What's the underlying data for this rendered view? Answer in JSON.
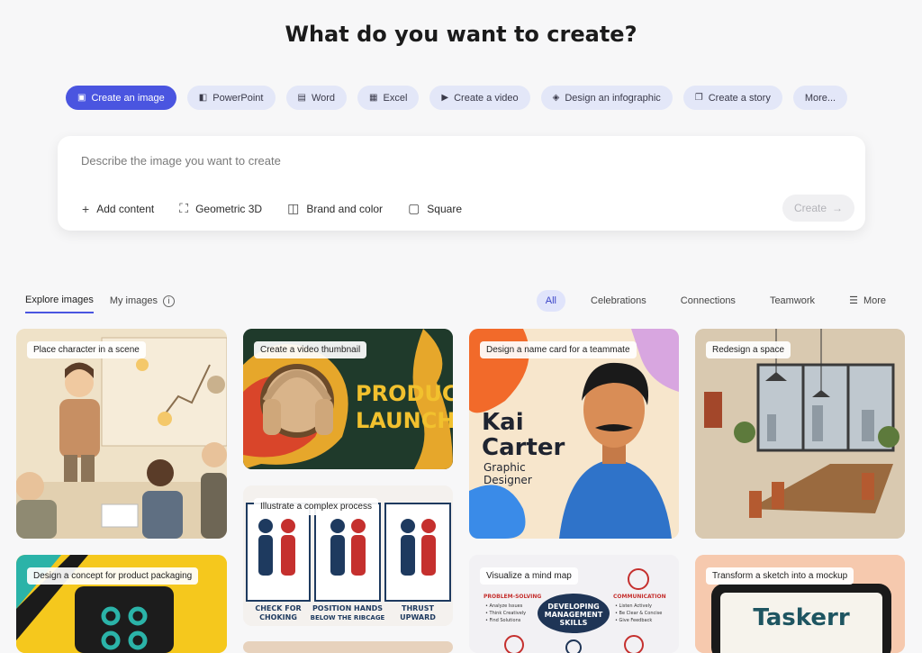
{
  "page": {
    "title": "What do you want to create?"
  },
  "chips": [
    {
      "label": "Create an image",
      "icon": "image-icon"
    },
    {
      "label": "PowerPoint",
      "icon": "powerpoint-icon"
    },
    {
      "label": "Word",
      "icon": "word-icon"
    },
    {
      "label": "Excel",
      "icon": "excel-icon"
    },
    {
      "label": "Create a video",
      "icon": "video-icon"
    },
    {
      "label": "Design an infographic",
      "icon": "infographic-icon"
    },
    {
      "label": "Create a story",
      "icon": "story-icon"
    },
    {
      "label": "More...",
      "icon": ""
    }
  ],
  "prompt": {
    "placeholder": "Describe the image you want to create",
    "value": "",
    "options": [
      {
        "label": "Add content",
        "icon": "plus-icon"
      },
      {
        "label": "Geometric 3D",
        "icon": "style-icon"
      },
      {
        "label": "Brand and color",
        "icon": "palette-icon"
      },
      {
        "label": "Square",
        "icon": "aspect-ratio-icon"
      }
    ],
    "create_label": "Create"
  },
  "tabs": {
    "explore": "Explore images",
    "mine": "My images"
  },
  "filters": {
    "all": "All",
    "celebrations": "Celebrations",
    "connections": "Connections",
    "teamwork": "Teamwork",
    "more": "More"
  },
  "cards": {
    "c1": "Place character in a scene",
    "c2": "Create a video thumbnail",
    "c3": "Design a name card for a teammate",
    "c4": "Redesign a space",
    "c5": "Illustrate a complex process",
    "c6": "Design a concept for product packaging",
    "c7": "Visualize a mind map",
    "c8": "Transform a sketch into a mockup"
  },
  "card_text": {
    "product": "PRODUCT",
    "launch": "LAUNCH",
    "kai": "Kai",
    "carter": "Carter",
    "graphic": "Graphic",
    "designer": "Designer",
    "step1a": "CHECK FOR",
    "step1b": "CHOKING",
    "step2a": "POSITION HANDS",
    "step2b": "BELOW THE RIBCAGE",
    "step3a": "THRUST",
    "step3b": "UPWARD",
    "mind_center_1": "DEVELOPING",
    "mind_center_2": "MANAGEMENT",
    "mind_center_3": "SKILLS",
    "mind_left_head": "PROBLEM-SOLVING",
    "mind_left_1": "• Analyze Issues",
    "mind_left_2": "• Think Creatively",
    "mind_left_3": "• Find Solutions",
    "mind_right_head": "COMMUNICATION",
    "mind_right_1": "• Listen Actively",
    "mind_right_2": "• Be Clear & Concise",
    "mind_right_3": "• Give Feedback",
    "taskerr": "Taskerr"
  },
  "colors": {
    "accent": "#4a55e0",
    "chip_bg": "#e3e7f8",
    "page_bg": "#f7f7f8"
  }
}
